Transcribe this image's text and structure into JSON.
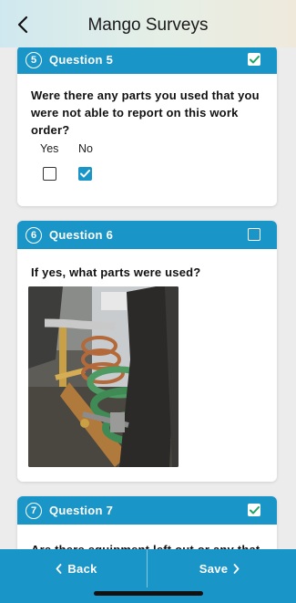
{
  "header": {
    "title": "Mango Surveys",
    "back_icon": "chevron-left-icon"
  },
  "colors": {
    "accent": "#1a95c8",
    "background": "#ececec",
    "card": "#ffffff"
  },
  "questions": [
    {
      "number": "5",
      "label": "Question 5",
      "answered": true,
      "text": "Were there any parts you used that you were not able to report on this work order?",
      "options": [
        {
          "label": "Yes",
          "checked": false
        },
        {
          "label": "No",
          "checked": true
        }
      ]
    },
    {
      "number": "6",
      "label": "Question 6",
      "answered": false,
      "text": "If yes, what parts were used?",
      "photo_icon": "attached-photo"
    },
    {
      "number": "7",
      "label": "Question 7",
      "answered": true,
      "text": "Are there equipment left out or any that"
    }
  ],
  "footer": {
    "back_label": "Back",
    "save_label": "Save"
  }
}
